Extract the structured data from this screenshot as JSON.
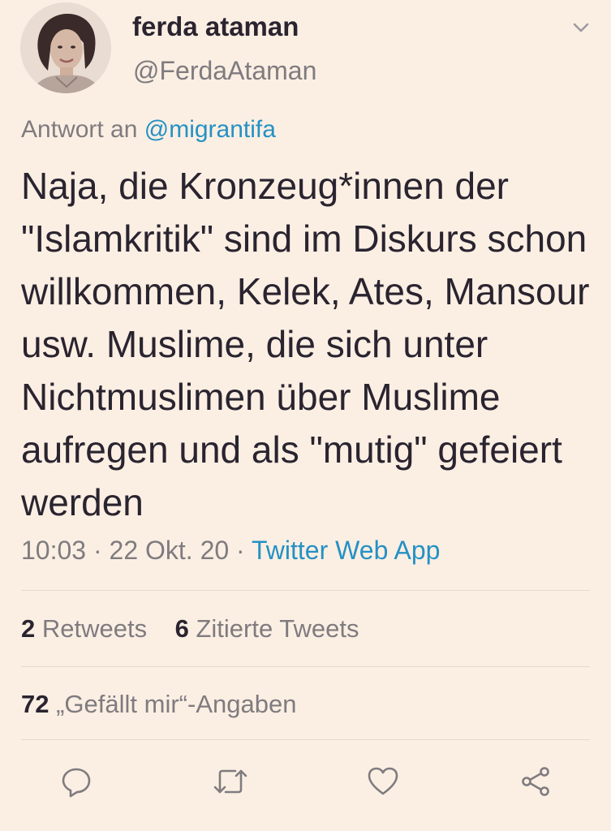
{
  "user": {
    "display_name": "ferda ataman",
    "handle": "@FerdaAtaman"
  },
  "reply": {
    "prefix": "Antwort an",
    "mention": "@migrantifa"
  },
  "tweet": {
    "text": "Naja, die Kronzeug*innen der \"Islamkritik\" sind im Diskurs schon willkommen, Kelek, Ates, Mansour usw. Muslime, die sich unter Nichtmuslimen über Muslime aufregen und als \"mutig\" gefeiert werden"
  },
  "meta": {
    "time": "10:03",
    "sep1": " · ",
    "date": "22 Okt. 20",
    "sep2": " · ",
    "source": "Twitter Web App"
  },
  "stats": {
    "retweets_count": "2",
    "retweets_label": "Retweets",
    "quotes_count": "6",
    "quotes_label": "Zitierte Tweets",
    "likes_count": "72",
    "likes_label": "„Gefällt mir“-Angaben"
  },
  "icons": {
    "caret": "chevron-down-icon",
    "reply": "reply-icon",
    "retweet": "retweet-icon",
    "like": "heart-icon",
    "share": "share-icon"
  },
  "colors": {
    "background": "#fbefe3",
    "text": "#2a2430",
    "secondary": "#7f7b7f",
    "link": "#2591c4"
  }
}
